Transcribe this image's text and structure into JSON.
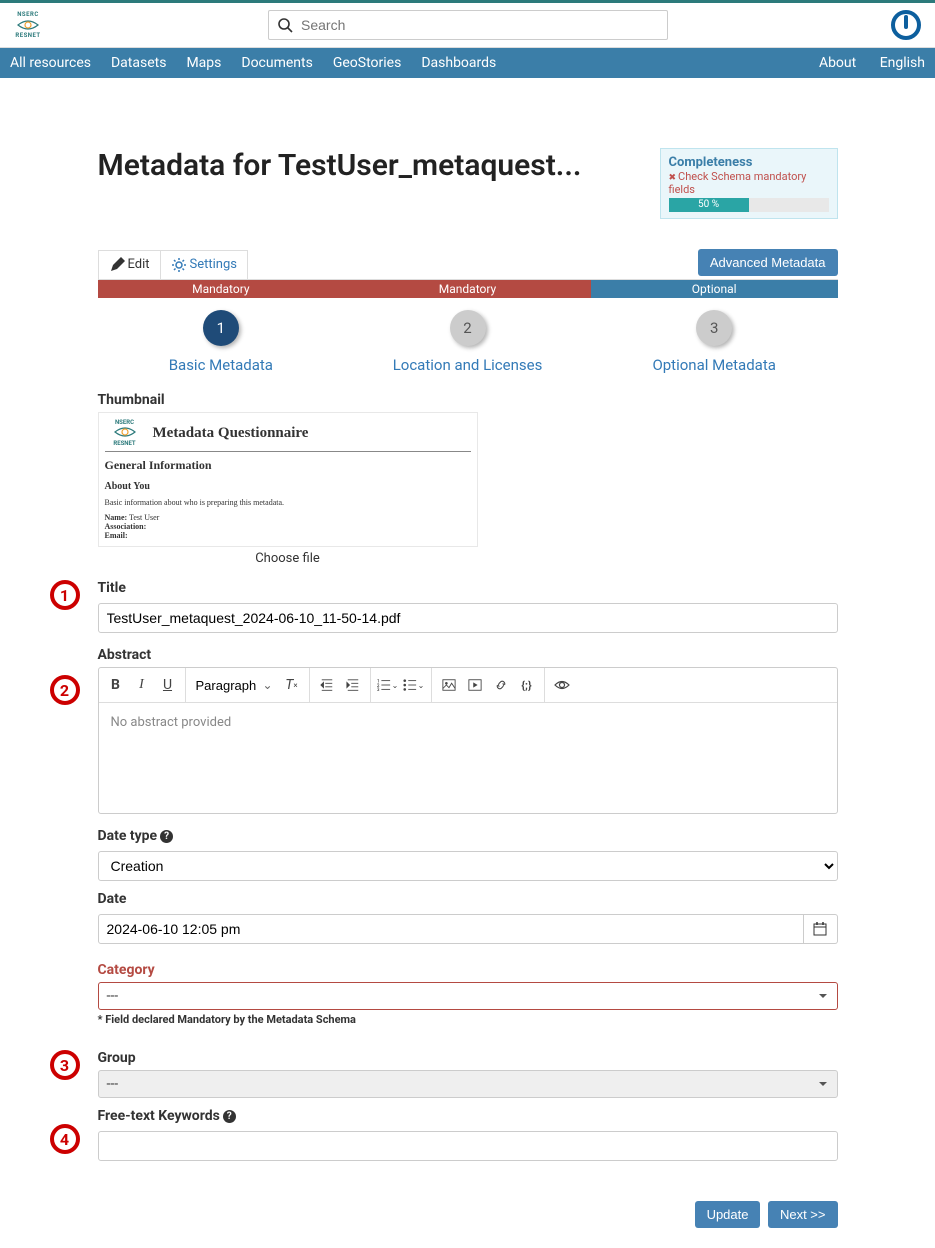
{
  "brand": {
    "top": "NSERC",
    "bottom": "RESNET"
  },
  "search": {
    "placeholder": "Search"
  },
  "nav": {
    "items": [
      "All resources",
      "Datasets",
      "Maps",
      "Documents",
      "GeoStories",
      "Dashboards"
    ],
    "right": [
      "About",
      "English"
    ]
  },
  "page_title": "Metadata for TestUser_metaquest...",
  "completeness": {
    "title": "Completeness",
    "check": "Check Schema mandatory fields",
    "percent": "50 %"
  },
  "tabs": {
    "edit": "Edit",
    "settings": "Settings",
    "advanced": "Advanced Metadata"
  },
  "stepper": {
    "bars": [
      "Mandatory",
      "Mandatory",
      "Optional"
    ],
    "steps": [
      {
        "n": "1",
        "label": "Basic Metadata"
      },
      {
        "n": "2",
        "label": "Location and Licenses"
      },
      {
        "n": "3",
        "label": "Optional Metadata"
      }
    ]
  },
  "fields": {
    "thumbnail_label": "Thumbnail",
    "thumb": {
      "title": "Metadata Questionnaire",
      "general": "General Information",
      "about": "About You",
      "desc": "Basic information about who is preparing this metadata.",
      "name_lbl": "Name:",
      "name_val": "Test User",
      "assoc_lbl": "Association:",
      "email_lbl": "Email:"
    },
    "choose_file": "Choose file",
    "title_label": "Title",
    "title_value": "TestUser_metaquest_2024-06-10_11-50-14.pdf",
    "abstract_label": "Abstract",
    "abstract_placeholder": "No abstract provided",
    "paragraph": "Paragraph",
    "date_type_label": "Date type",
    "date_type_value": "Creation",
    "date_label": "Date",
    "date_value": "2024-06-10 12:05 pm",
    "category_label": "Category",
    "category_value": "---",
    "category_note": "* Field declared Mandatory by the Metadata Schema",
    "group_label": "Group",
    "group_value": "---",
    "keywords_label": "Free-text Keywords"
  },
  "annotations": {
    "a1": "1",
    "a2": "2",
    "a3": "3",
    "a4": "4"
  },
  "buttons": {
    "update": "Update",
    "next": "Next >>"
  }
}
